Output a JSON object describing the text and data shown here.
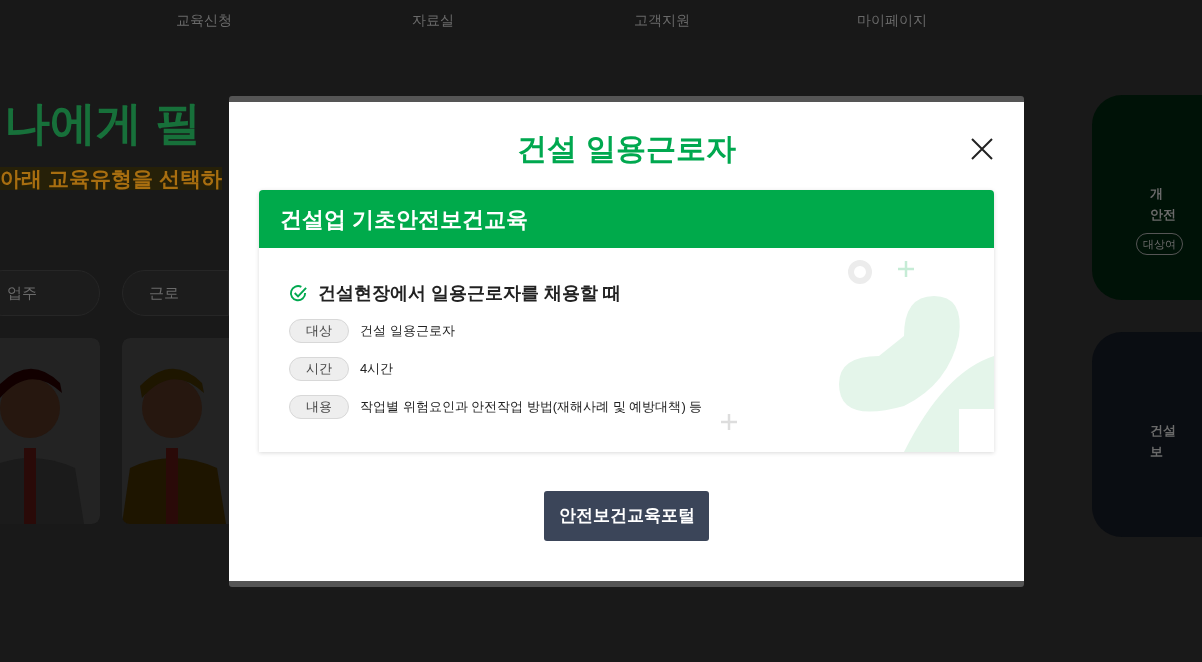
{
  "nav": [
    "교육신청",
    "자료실",
    "고객지원",
    "마이페이지"
  ],
  "hero": {
    "title": "나에게 필",
    "subtitle": "아래 교육유형을 선택하"
  },
  "type_tabs": [
    {
      "label": "업주"
    },
    {
      "label": "근로"
    }
  ],
  "side_cards": [
    {
      "lines": [
        "개",
        "안전"
      ],
      "button": "대상여"
    },
    {
      "lines": [
        "건설",
        "보"
      ]
    }
  ],
  "modal": {
    "title": "건설 일용근로자",
    "course": {
      "title": "건설업 기초안전보건교육",
      "headline": "건설현장에서 일용근로자를 채용할 때",
      "items": [
        {
          "label": "대상",
          "value": "건설 일용근로자"
        },
        {
          "label": "시간",
          "value": "4시간"
        },
        {
          "label": "내용",
          "value": "작업별 위험요인과 안전작업 방법(재해사례 및 예방대책) 등"
        }
      ]
    },
    "button": "안전보건교육포털"
  }
}
